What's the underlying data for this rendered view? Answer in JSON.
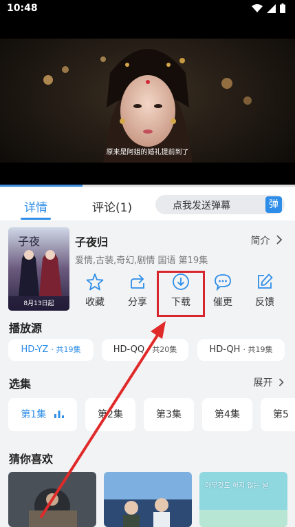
{
  "status": {
    "time": "10:48"
  },
  "video": {
    "subtitle": "原来是阿姐的婚礼提前到了",
    "progress_percent": 28
  },
  "tabs": {
    "detail": "详情",
    "comment": "评论(1)"
  },
  "danmu": {
    "placeholder": "点我发送弹幕",
    "button": "弹"
  },
  "poster": {
    "date_text": "8月13日起"
  },
  "show": {
    "title": "子夜归",
    "intro_label": "简介",
    "meta": "爱情,古装,奇幻,剧情 国语 第19集"
  },
  "actions": {
    "favorite": "收藏",
    "share": "分享",
    "download": "下载",
    "urge": "催更",
    "feedback": "反馈"
  },
  "sources": {
    "title": "播放源",
    "items": [
      {
        "name": "HD-YZ",
        "count": "· 共19集"
      },
      {
        "name": "HD-QQ",
        "count": "· 共20集"
      },
      {
        "name": "HD-QH",
        "count": "· 共19集"
      }
    ]
  },
  "episodes": {
    "title": "选集",
    "expand_label": "展开",
    "items": [
      "第1集",
      "第2集",
      "第3集",
      "第4集",
      "第5"
    ]
  },
  "recommend": {
    "title": "猜你喜欢",
    "card3_text": "아무것도 하지 않는 날"
  },
  "colors": {
    "accent": "#2d8de8",
    "highlight": "#d7262d"
  }
}
